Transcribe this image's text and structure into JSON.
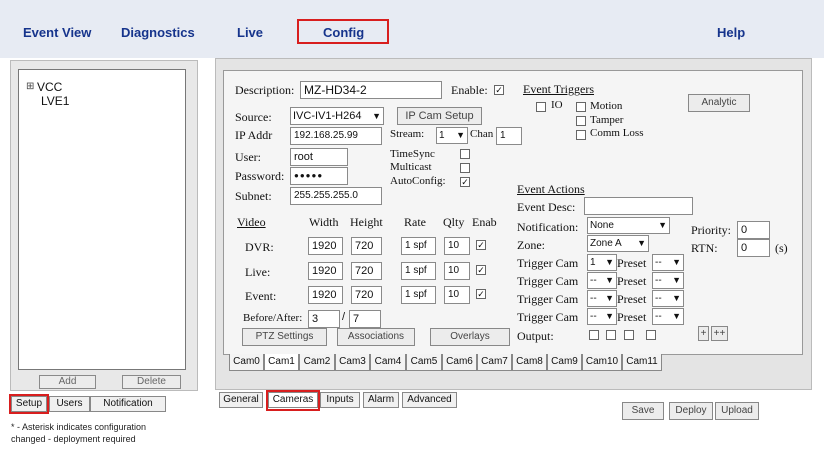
{
  "nav": {
    "event_view": "Event View",
    "diagnostics": "Diagnostics",
    "live": "Live",
    "config": "Config",
    "help": "Help"
  },
  "tree": {
    "root": "VCC",
    "child": "LVE1",
    "expand": "⊞"
  },
  "left_buttons": {
    "add": "Add",
    "delete": "Delete"
  },
  "left_tabs": [
    "Setup",
    "Users",
    "Notification"
  ],
  "footnote": [
    "* - Asterisk indicates configuration",
    "changed - deployment required"
  ],
  "form": {
    "description_label": "Description:",
    "description_value": "MZ-HD34-2",
    "enable_label": "Enable:",
    "source_label": "Source:",
    "source_value": "IVC-IV1-H264",
    "ip_cam_setup": "IP Cam Setup",
    "ip_label": "IP Addr",
    "ip_value": "192.168.25.99",
    "stream_label": "Stream:",
    "stream_value": "1",
    "chan_label": "Chan",
    "chan_value": "1",
    "user_label": "User:",
    "user_value": "root",
    "password_label": "Password:",
    "password_value": "●●●●●",
    "subnet_label": "Subnet:",
    "subnet_value": "255.255.255.0",
    "timesync_label": "TimeSync",
    "multicast_label": "Multicast",
    "autoconfig_label": "AutoConfig:",
    "event_triggers": "Event Triggers",
    "trig_io": "IO",
    "trig_motion": "Motion",
    "trig_tamper": "Tamper",
    "trig_commloss": "Comm Loss",
    "analytic": "Analytic",
    "video_hdr": {
      "video": "Video",
      "width": "Width",
      "height": "Height",
      "rate": "Rate",
      "qlty": "Qlty",
      "enab": "Enab"
    },
    "video_rows": [
      {
        "label": "DVR:",
        "width": "1920",
        "height": "720",
        "rate": "1 spf",
        "qlty": "10"
      },
      {
        "label": "Live:",
        "width": "1920",
        "height": "720",
        "rate": "1 spf",
        "qlty": "10"
      },
      {
        "label": "Event:",
        "width": "1920",
        "height": "720",
        "rate": "1 spf",
        "qlty": "10"
      }
    ],
    "before_after_label": "Before/After:",
    "before_value": "3",
    "after_value": "7",
    "ptz_settings": "PTZ Settings",
    "associations": "Associations",
    "overlays": "Overlays",
    "event_actions": "Event Actions",
    "event_desc_label": "Event Desc:",
    "notification_label": "Notification:",
    "notification_value": "None",
    "zone_label": "Zone:",
    "zone_value": "Zone A",
    "trigger_cam_label": "Trigger Cam",
    "preset_label": "Preset",
    "trigger_rows": [
      {
        "cam": "1",
        "preset": "--"
      },
      {
        "cam": "--",
        "preset": "--"
      },
      {
        "cam": "--",
        "preset": "--"
      },
      {
        "cam": "--",
        "preset": "--"
      }
    ],
    "output_label": "Output:",
    "priority_label": "Priority:",
    "priority_value": "0",
    "rtn_label": "RTN:",
    "rtn_value": "0",
    "rtn_unit": "(s)",
    "plus": "+",
    "plusplus": "++"
  },
  "cam_tabs": [
    "Cam0",
    "Cam1",
    "Cam2",
    "Cam3",
    "Cam4",
    "Cam5",
    "Cam6",
    "Cam7",
    "Cam8",
    "Cam9",
    "Cam10",
    "Cam11"
  ],
  "bottom_tabs": [
    "General",
    "Cameras",
    "Inputs",
    "Alarm",
    "Advanced"
  ],
  "actions": {
    "save": "Save",
    "deploy": "Deploy",
    "upload": "Upload"
  },
  "colors": {
    "nav_text": "#16348c",
    "highlight": "#d81e1e"
  }
}
